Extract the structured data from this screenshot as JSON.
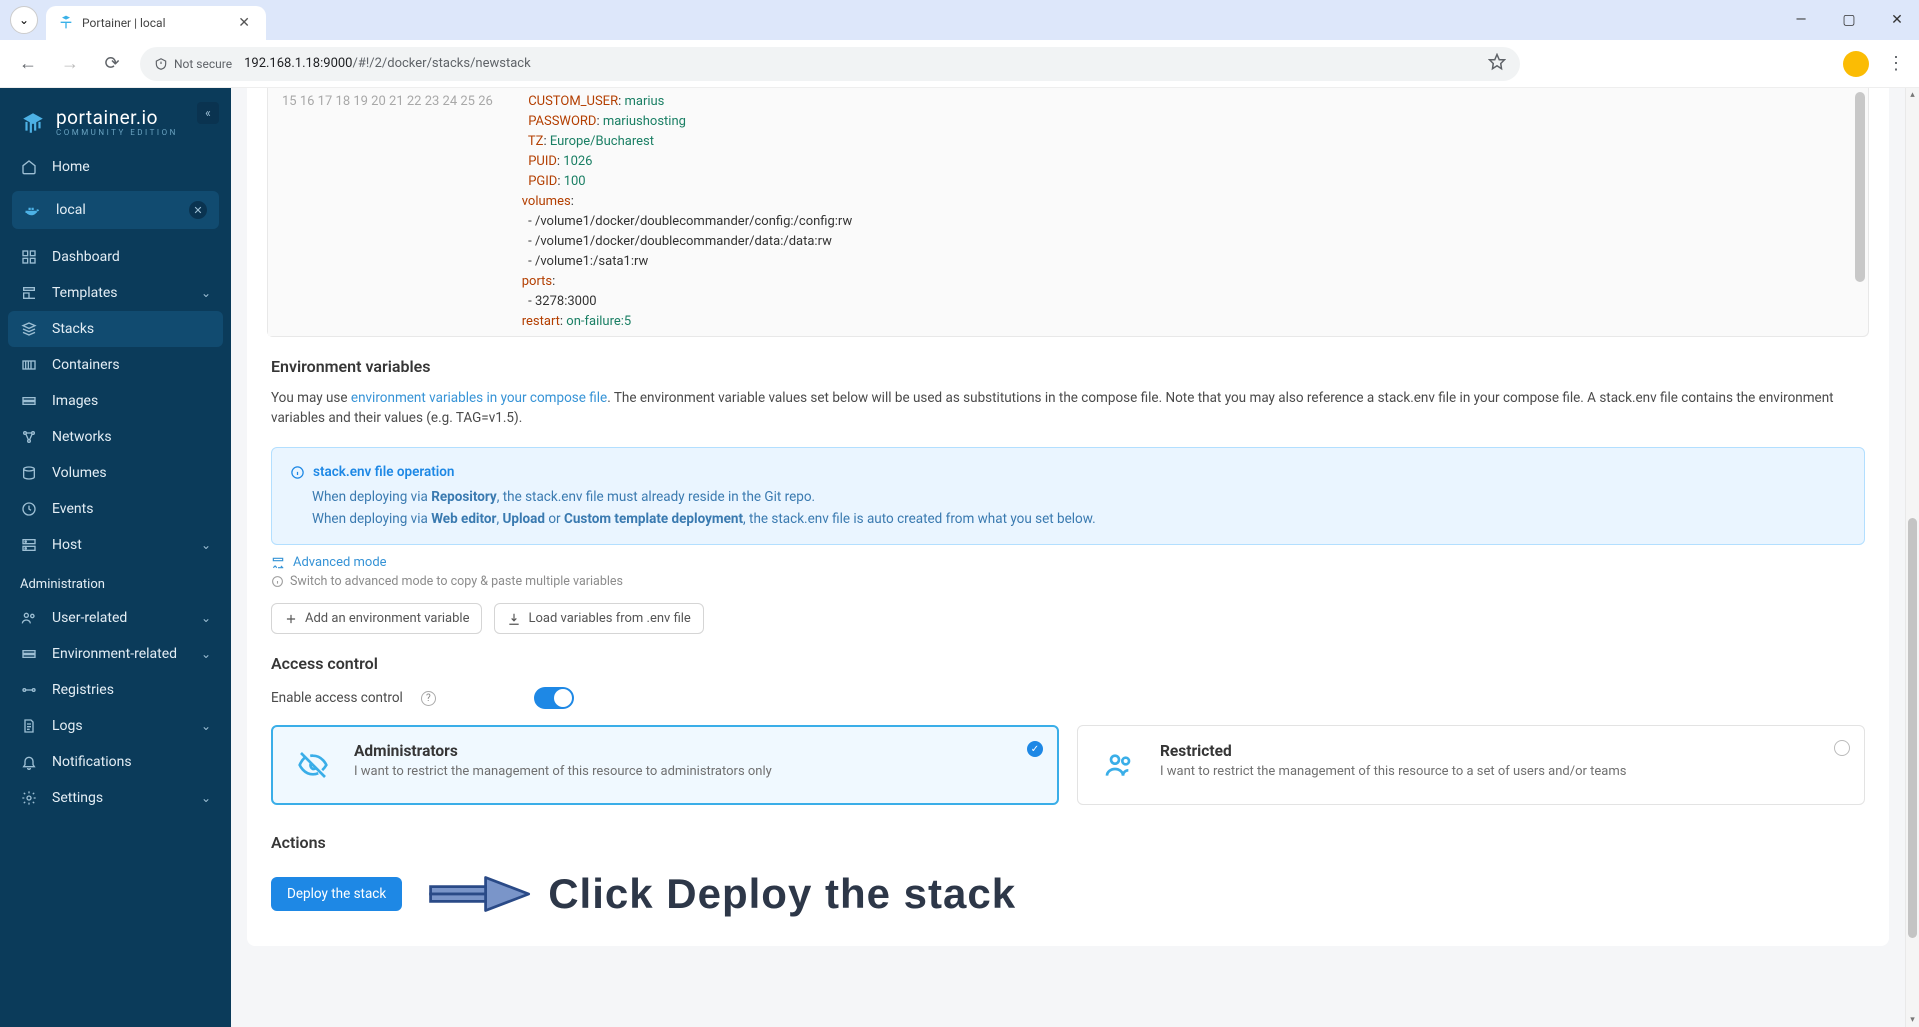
{
  "browser": {
    "tab_title": "Portainer | local",
    "secure_label": "Not secure",
    "url_host": "192.168.1.18:9000",
    "url_path": "/#!/2/docker/stacks/newstack"
  },
  "brand": {
    "title": "portainer.io",
    "sub": "COMMUNITY EDITION"
  },
  "sidebar": {
    "home": "Home",
    "env": "local",
    "items": [
      "Dashboard",
      "Templates",
      "Stacks",
      "Containers",
      "Images",
      "Networks",
      "Volumes",
      "Events",
      "Host"
    ],
    "admin_label": "Administration",
    "admin_items": [
      "User-related",
      "Environment-related",
      "Registries",
      "Logs",
      "Notifications",
      "Settings"
    ]
  },
  "editor": {
    "lines": [
      {
        "n": 15,
        "key": "CUSTOM_USER",
        "val": "marius"
      },
      {
        "n": 16,
        "key": "PASSWORD",
        "val": "mariushosting"
      },
      {
        "n": 17,
        "key": "TZ",
        "val": "Europe/Bucharest"
      },
      {
        "n": 18,
        "key": "PUID",
        "val": "1026"
      },
      {
        "n": 19,
        "key": "PGID",
        "val": "100"
      },
      {
        "n": 20,
        "key": "volumes",
        "val": ""
      },
      {
        "n": 21,
        "raw": "  - /volume1/docker/doublecommander/config:/config:rw"
      },
      {
        "n": 22,
        "raw": "  - /volume1/docker/doublecommander/data:/data:rw"
      },
      {
        "n": 23,
        "raw": "  - /volume1:/sata1:rw"
      },
      {
        "n": 24,
        "key": "ports",
        "val": ""
      },
      {
        "n": 25,
        "raw": "  - 3278:3000"
      },
      {
        "n": 26,
        "key": "restart",
        "val": "on-failure:5"
      }
    ]
  },
  "env": {
    "title": "Environment variables",
    "desc_a": "You may use ",
    "desc_link": "environment variables in your compose file",
    "desc_b": ". The environment variable values set below will be used as substitutions in the compose file. Note that you may also reference a stack.env file in your compose file. A stack.env file contains the environment variables and their values (e.g. TAG=v1.5).",
    "info_title": "stack.env file operation",
    "info_l1a": "When deploying via ",
    "info_l1b": "Repository",
    "info_l1c": ", the stack.env file must already reside in the Git repo.",
    "info_l2a": "When deploying via ",
    "info_l2b": "Web editor",
    "info_l2c": ", ",
    "info_l2d": "Upload",
    "info_l2e": " or ",
    "info_l2f": "Custom template deployment",
    "info_l2g": ", the stack.env file is auto created from what you set below.",
    "adv_mode": "Advanced mode",
    "adv_hint": "Switch to advanced mode to copy & paste multiple variables",
    "btn_add": "Add an environment variable",
    "btn_load": "Load variables from .env file"
  },
  "access": {
    "title": "Access control",
    "enable": "Enable access control",
    "admin_title": "Administrators",
    "admin_desc": "I want to restrict the management of this resource to administrators only",
    "restricted_title": "Restricted",
    "restricted_desc": "I want to restrict the management of this resource to a set of users and/or teams"
  },
  "actions": {
    "title": "Actions",
    "deploy": "Deploy the stack",
    "annotation": "Click Deploy the stack"
  }
}
